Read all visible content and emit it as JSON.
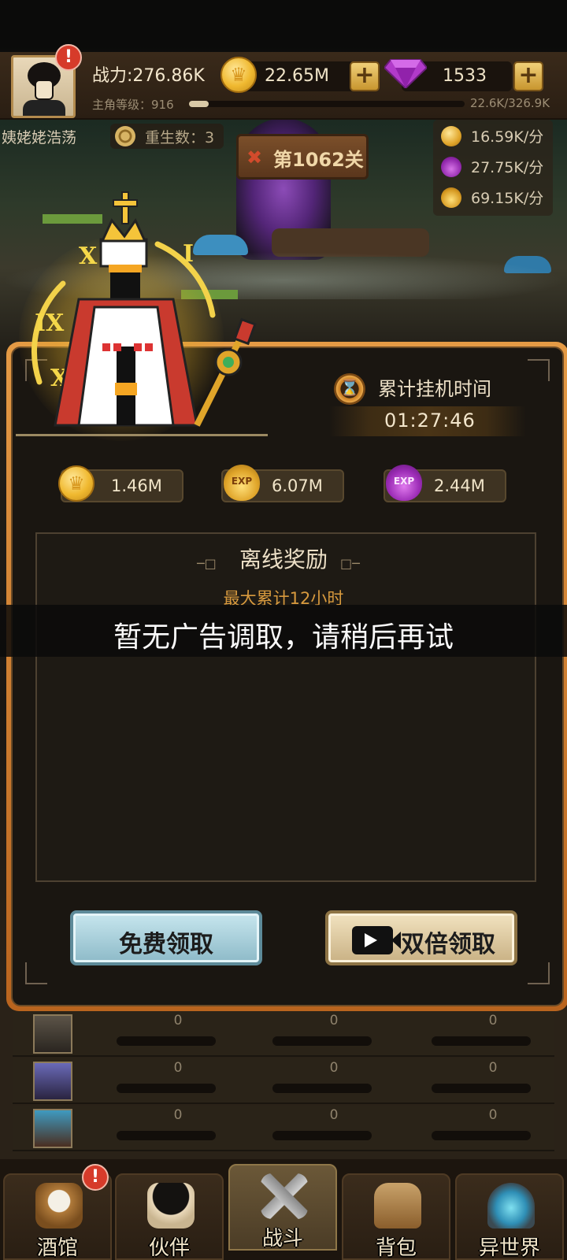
{
  "header": {
    "power": "战力:276.86K",
    "level_label": "主角等级：916",
    "level_progress": 0.07,
    "level_exp": "22.6K/326.9K",
    "gold": "22.65M",
    "gems": "1533",
    "avatar_alert": "!"
  },
  "status": {
    "player_name": "姨姥姥浩荡",
    "rebirth_label": "重生数：3",
    "stage": "第1062关",
    "rates": [
      {
        "icon": "gold-coin-icon",
        "value": "16.59K/分"
      },
      {
        "icon": "purple-exp-icon",
        "value": "27.75K/分"
      },
      {
        "icon": "gold-exp-icon",
        "value": "69.15K/分"
      }
    ]
  },
  "dialog": {
    "idle_time_label": "累计挂机时间",
    "idle_time_value": "01:27:46",
    "rewards": [
      {
        "icon": "gold-coin-icon",
        "value": "1.46M"
      },
      {
        "icon": "gold-exp-icon",
        "value": "6.07M",
        "icon_text": "EXP"
      },
      {
        "icon": "purple-exp-icon",
        "value": "2.44M",
        "icon_text": "EXP"
      }
    ],
    "panel_title": "离线奖励",
    "panel_sub": "最大累计12小时",
    "free_claim": "免费领取",
    "double_claim": "双倍领取"
  },
  "toast": "暂无广告调取，请稍后再试",
  "partner_rows": [
    {
      "values": [
        "0",
        "0",
        "0"
      ]
    },
    {
      "values": [
        "0",
        "0",
        "0"
      ]
    },
    {
      "values": [
        "0",
        "0",
        "0"
      ]
    }
  ],
  "nav": {
    "items": [
      {
        "label": "酒馆",
        "icon": "beer-mug-icon",
        "alert": "!"
      },
      {
        "label": "伙伴",
        "icon": "partner-icon"
      },
      {
        "label": "战斗",
        "icon": "crossed-swords-icon"
      },
      {
        "label": "背包",
        "icon": "backpack-icon"
      },
      {
        "label": "异世界",
        "icon": "portal-icon"
      }
    ],
    "active": "战斗"
  },
  "colors": {
    "dialog_border": "#e49a45",
    "accent_gold": "#d89a3e",
    "free_button": "#8dbac8",
    "double_button": "#c9b184"
  }
}
